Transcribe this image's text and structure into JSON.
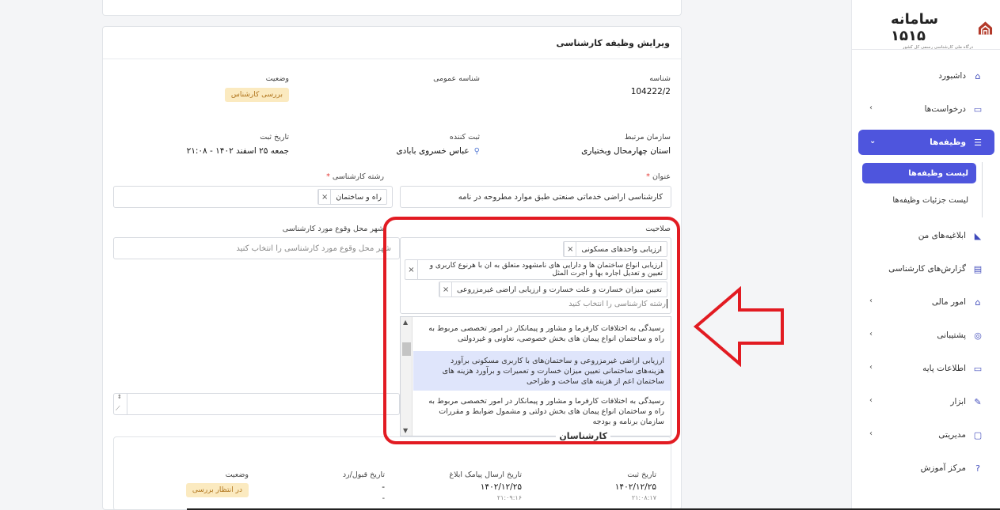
{
  "sidebar": {
    "logo_text": "سامانه ۱۵۱۵",
    "logo_sub": "درگاه ملی کارشناسی رسمی کل کشور",
    "items": [
      {
        "label": "داشبورد",
        "icon": "home-icon",
        "glyph": "⌂"
      },
      {
        "label": "درخواست‌ها",
        "icon": "inbox-icon",
        "glyph": "▭"
      },
      {
        "label": "وظیفه‌ها",
        "icon": "clipboard-icon",
        "glyph": "☰"
      },
      {
        "label": "ابلاغیه‌های من",
        "icon": "megaphone-icon",
        "glyph": "◣"
      },
      {
        "label": "گزارش‌های کارشناسی",
        "icon": "report-icon",
        "glyph": "▤"
      },
      {
        "label": "امور مالی",
        "icon": "bank-icon",
        "glyph": "⌂"
      },
      {
        "label": "پشتیبانی",
        "icon": "support-icon",
        "glyph": "◎"
      },
      {
        "label": "اطلاعات پایه",
        "icon": "database-icon",
        "glyph": "▭"
      },
      {
        "label": "ابزار",
        "icon": "tool-icon",
        "glyph": "✎"
      },
      {
        "label": "مدیریتی",
        "icon": "monitor-icon",
        "glyph": "▢"
      },
      {
        "label": "مرکز آموزش",
        "icon": "help-icon",
        "glyph": "?"
      }
    ],
    "subitems": [
      "لیست وظیفه‌ها",
      "لیست جزئیات وظیفه‌ها"
    ]
  },
  "card": {
    "title": "ویرایش وظیفه کارشناسی",
    "fields": {
      "id_label": "شناسه",
      "id_value": "104222/2",
      "public_id_label": "شناسه عمومی",
      "status_label": "وضعیت",
      "status_value": "بررسی کارشناس",
      "org_label": "سازمان مرتبط",
      "org_value": "استان چهارمحال وبختیاری",
      "creator_label": "ثبت کننده",
      "creator_value": "عباس خسروی بابادی",
      "reg_date_label": "تاریخ ثبت",
      "reg_date_value": "جمعه ۲۵ اسفند ۱۴۰۲ - ۲۱:۰۸",
      "title_label": "عنوان",
      "title_value": "کارشناسی اراضی خدماتی صنعتی  طبق موارد مطروحه در نامه",
      "field_label": "رشته کارشناسی",
      "field_tag": "راه و ساختمان",
      "competency_label": "صلاحیت",
      "city_label": "شهر محل وقوع مورد کارشناسی",
      "city_placeholder": "شهر محل وقوع مورد کارشناسی را انتخاب کنید"
    },
    "competency_tags": [
      "ارزیابی واحدهای مسکونی",
      "ارزیابی انواع ساختمان ها و دارایی های نامشهود متعلق به ان با هرنوع کاربری و تعیین و تعدیل اجاره بها و اجرت المثل",
      "تعیین میزان خسارت و علت خسارت و ارزیابی اراضی غیرمزروعی"
    ],
    "competency_placeholder": "رشته کارشناسی را انتخاب کنید",
    "dropdown_options": [
      "رسیدگی به اختلافات کارفرما و مشاور و پیمانکار در امور تخصصی مربوط به راه و ساختمان انواع پیمان های بخش خصوصی، تعاونی و غیردولتی",
      "ارزیابی اراضی غیرمزروعی و ساختمان‌های با کاربری مسکونی برآورد هزینه‌های ساختمانی تعیین میزان خسارت و تعمیرات و برآورد هزینه های ساختمان اعم از هزینه های ساخت و طراحی",
      "رسیدگی به اختلافات کارفرما و مشاور و پیمانکار در امور تخصصی مربوط به راه و ساختمان انواع پیمان های بخش دولتی و مشمول ضوابط و مقررات سازمان برنامه و بودجه"
    ]
  },
  "subcard": {
    "title": "کارشناسان",
    "reg_date_label": "تاریخ ثبت",
    "reg_date_value": "۱۴۰۲/۱۲/۲۵",
    "reg_time_value": "۲۱:۰۸:۱۷",
    "sms_label": "تاریخ ارسال پیامک ابلاغ",
    "sms_date_value": "۱۴۰۲/۱۲/۲۵",
    "sms_time_value": "۲۱:۰۹:۱۶",
    "accept_label": "تاریخ قبول/رد",
    "accept_value1": "-",
    "accept_value2": "-",
    "status_label": "وضعیت",
    "status_value": "در انتظار بررسی"
  },
  "colors": {
    "accent": "#4e55dd",
    "annotation_red": "#e21b22",
    "badge_bg": "#fbeac0",
    "badge_text": "#b0741c"
  }
}
